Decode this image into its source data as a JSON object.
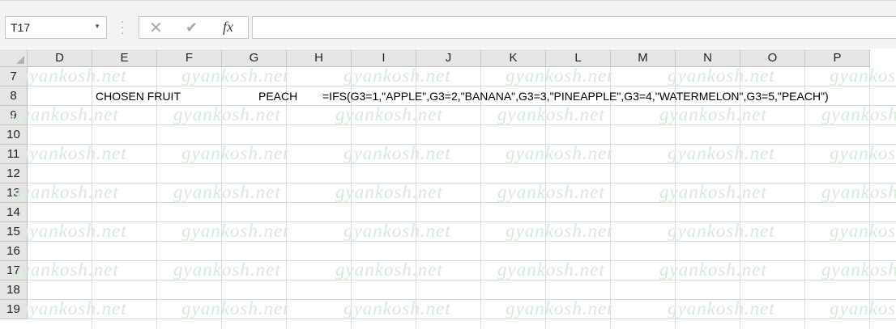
{
  "namebox": {
    "value": "T17"
  },
  "formula_bar": {
    "value": "",
    "fx_label": "fx"
  },
  "columns": [
    "D",
    "E",
    "F",
    "G",
    "H",
    "I",
    "J",
    "K",
    "L",
    "M",
    "N",
    "O",
    "P"
  ],
  "rows": [
    "7",
    "8",
    "9",
    "10",
    "11",
    "12",
    "13",
    "14",
    "15",
    "16",
    "17",
    "18",
    "19"
  ],
  "cells": {
    "E8": "CHOSEN FRUIT",
    "G8": "PEACH",
    "H8": "=IFS(G3=1,\"APPLE\",G3=2,\"BANANA\",G3=3,\"PINEAPPLE\",G3=4,\"WATERMELON\",G3=5,\"PEACH\")"
  },
  "watermark": "gyankosh.net",
  "colors": {
    "watermark": "#d6ead7",
    "header_bg": "#e6e6e6",
    "gridline": "#dadada"
  }
}
